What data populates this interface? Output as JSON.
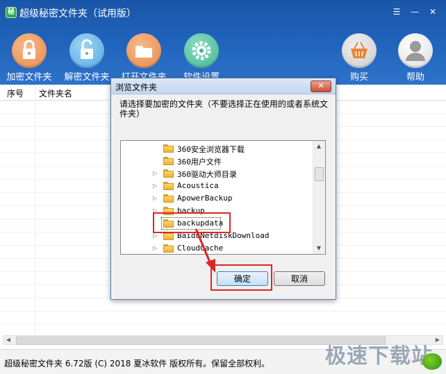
{
  "app": {
    "title": "超级秘密文件夹（试用版）",
    "logo_glyph": "秘",
    "window_controls": {
      "menu": "☰",
      "minimize": "—",
      "close": "✕"
    }
  },
  "toolbar": {
    "encrypt": "加密文件夹",
    "decrypt": "解密文件夹",
    "open": "打开文件夹",
    "settings": "软件设置",
    "buy": "购买",
    "help": "帮助"
  },
  "table": {
    "columns": [
      "序号",
      "文件夹名"
    ],
    "rows": []
  },
  "status": {
    "text": "超级秘密文件夹 6.72版 (C) 2018 夏冰软件 版权所有。保留全部权利。"
  },
  "watermark": {
    "text": "极速下载站"
  },
  "dialog": {
    "title": "浏览文件夹",
    "close": "✕",
    "prompt": "请选择要加密的文件夹（不要选择正在使用的或者系统文件夹）",
    "tree": [
      {
        "name": "360安全浏览器下载",
        "expandable": false,
        "selected": false
      },
      {
        "name": "360用户文件",
        "expandable": false,
        "selected": false
      },
      {
        "name": "360驱动大师目录",
        "expandable": true,
        "selected": false
      },
      {
        "name": "Acoustica",
        "expandable": true,
        "selected": false
      },
      {
        "name": "ApowerBackup",
        "expandable": true,
        "selected": false
      },
      {
        "name": "backup",
        "expandable": true,
        "selected": false
      },
      {
        "name": "backupdata",
        "expandable": false,
        "selected": true
      },
      {
        "name": "BaiduNetdiskDownload",
        "expandable": true,
        "selected": false
      },
      {
        "name": "CloudCache",
        "expandable": true,
        "selected": false
      },
      {
        "name": "",
        "expandable": true,
        "selected": false
      }
    ],
    "ok": "确定",
    "cancel": "取消"
  },
  "colors": {
    "header": "#1f62ba",
    "highlight": "#e02424"
  }
}
